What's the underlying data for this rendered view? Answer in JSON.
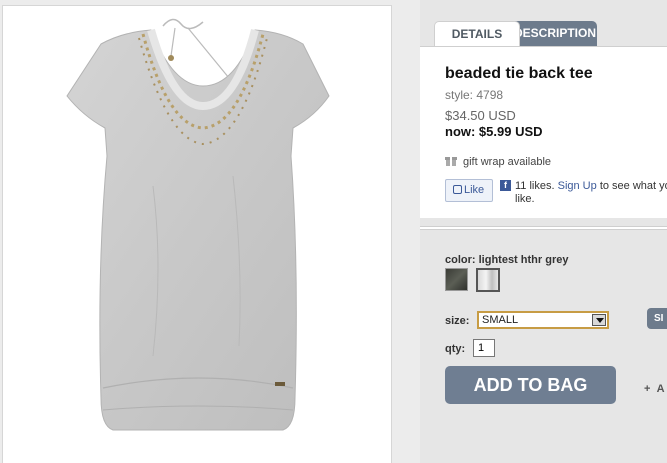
{
  "tabs": {
    "details": "DETAILS",
    "description": "DESCRIPTION"
  },
  "product": {
    "title": "beaded tie back tee",
    "style": "style: 4798",
    "price": "$34.50 USD",
    "now_price": "now: $5.99 USD"
  },
  "gift": {
    "label": "gift wrap available"
  },
  "facebook": {
    "like": "Like",
    "likes": "11 likes.",
    "signup": "Sign Up",
    "tail": "to see what yo",
    "tail2": "like."
  },
  "options": {
    "color_label": "color: lightest hthr grey",
    "size_label": "size:",
    "size_value": "SMALL",
    "size_chart": "SI",
    "qty_label": "qty:",
    "qty_value": "1"
  },
  "actions": {
    "add_to_bag": "ADD TO BAG",
    "secondary": "A"
  },
  "colors": {
    "tab_active_bg": "#ffffff",
    "tab_inactive_bg": "#6d7b8c",
    "button_bg": "#6f7e92",
    "select_border": "#c79c44"
  }
}
